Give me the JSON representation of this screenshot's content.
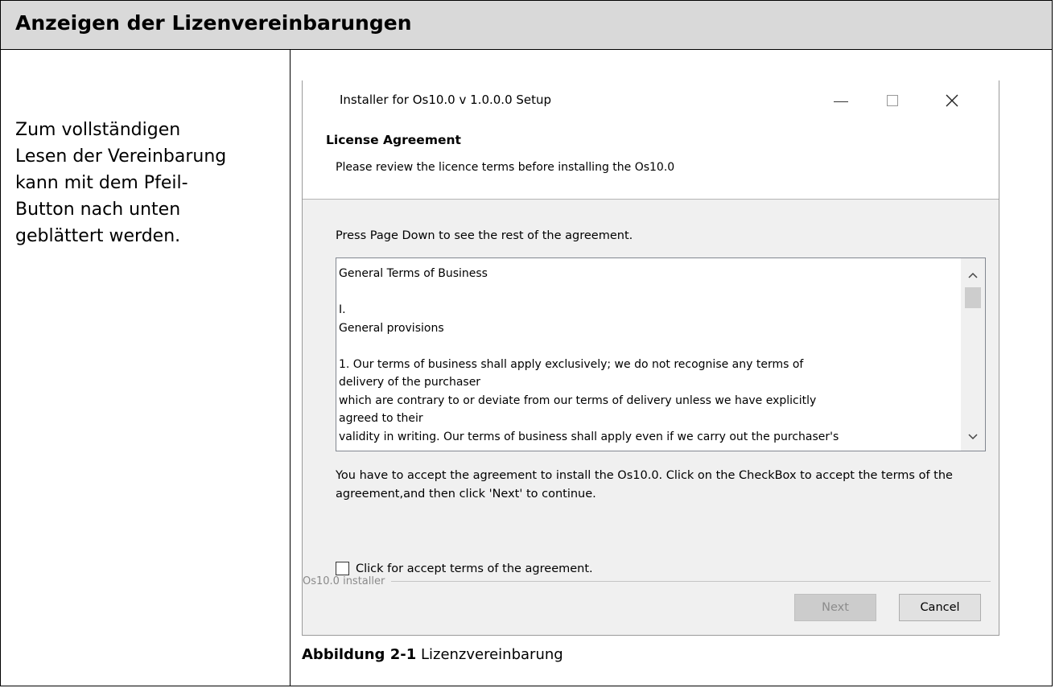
{
  "document": {
    "heading": "Anzeigen der Lizenvereinbarungen",
    "instruction_text": "Zum vollständigen\nLesen der Vereinbarung\nkann mit dem Pfeil-\nButton nach unten\ngeblättert werden.",
    "figure_caption": {
      "number": "Abbildung 2-1",
      "title": "Lizenzvereinbarung"
    }
  },
  "installer": {
    "window_title": "Installer for Os10.0 v 1.0.0.0 Setup",
    "controls": {
      "minimize": "—",
      "maximize": "□",
      "close": "✕"
    },
    "section_heading": "License Agreement",
    "section_subtitle": "Please review the licence terms before installing the Os10.0",
    "page_down_hint": "Press Page Down to see the rest of the agreement.",
    "license_lines": [
      "General Terms of Business",
      "",
      "I.",
      "General provisions",
      "",
      "1. Our terms of business shall apply exclusively; we do not recognise any terms of",
      "delivery of the purchaser",
      "which are contrary to or deviate from our terms of delivery unless we have explicitly",
      "agreed to their",
      "validity in writing. Our terms of business shall apply even if we carry out the purchaser's"
    ],
    "scroll_up_icon": "^",
    "scroll_down_icon": "v",
    "accept_info": "You have to accept the agreement to install the Os10.0. Click on the CheckBox to accept the terms of the agreement,and then  click 'Next' to continue.",
    "checkbox_label": "Click for accept terms of the agreement.",
    "checkbox_checked": false,
    "group_label": "Os10.0 installer",
    "next_button": "Next",
    "next_enabled": false,
    "cancel_button": "Cancel"
  }
}
